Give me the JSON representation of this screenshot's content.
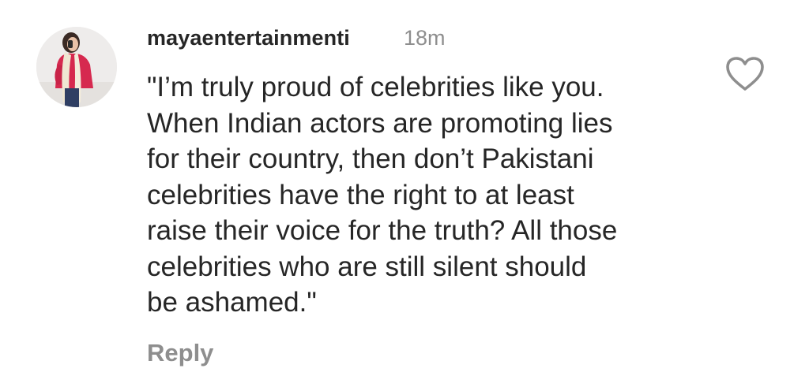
{
  "comment": {
    "username": "mayaentertainmenti",
    "timestamp": "18m",
    "text_lines": [
      "\"I’m truly proud of celebrities like you.",
      "When Indian actors are promoting lies",
      "for their country, then don’t Pakistani",
      "celebrities have the right to at least",
      "raise their voice for the truth? All those",
      "celebrities who are still silent should",
      "be ashamed.\""
    ],
    "reply_label": "Reply",
    "like_icon": "heart-outline-icon",
    "avatar_icon": "profile-photo"
  }
}
